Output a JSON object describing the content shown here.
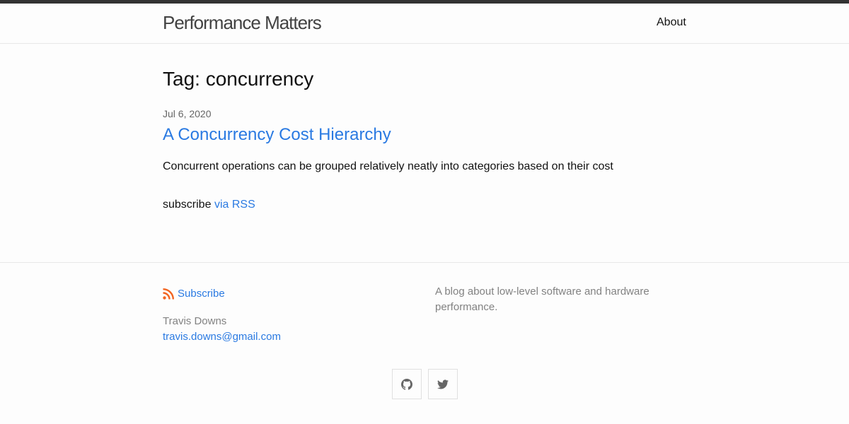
{
  "header": {
    "site_title": "Performance Matters",
    "nav": [
      {
        "label": "About"
      }
    ]
  },
  "main": {
    "heading": "Tag: concurrency",
    "posts": [
      {
        "date": "Jul 6, 2020",
        "title": "A Concurrency Cost Hierarchy",
        "excerpt": "Concurrent operations can be grouped relatively neatly into categories based on their cost"
      }
    ],
    "rss_prefix": "subscribe",
    "rss_link": "via RSS"
  },
  "footer": {
    "subscribe_label": "Subscribe",
    "author": "Travis Downs",
    "email": "travis.downs@gmail.com",
    "description": "A blog about low-level software and hardware performance.",
    "social": [
      {
        "icon": "github-icon"
      },
      {
        "icon": "twitter-icon"
      }
    ]
  },
  "colors": {
    "link": "#2a7ae2",
    "rss": "#f26522",
    "top_bar": "#333333",
    "muted": "#828282"
  }
}
